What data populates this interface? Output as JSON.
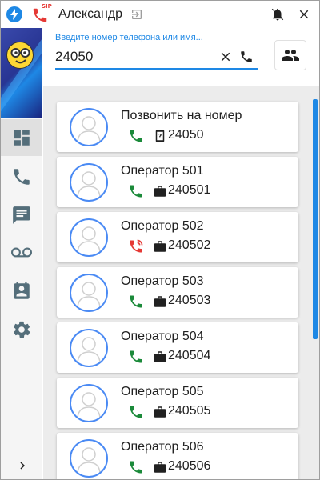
{
  "titlebar": {
    "sip_badge": "SIP",
    "user_name": "Александр"
  },
  "search": {
    "hint": "Введите номер телефона или имя...",
    "value": "24050"
  },
  "colors": {
    "accent": "#1e88e5",
    "call_green": "#1b8a3a",
    "call_red": "#e53935",
    "icon_grey": "#546e7a"
  },
  "sidebar": {
    "items": [
      {
        "name": "dashboard",
        "icon": "dashboard-icon",
        "active": true
      },
      {
        "name": "calls",
        "icon": "phone-icon",
        "active": false
      },
      {
        "name": "messages",
        "icon": "message-icon",
        "active": false
      },
      {
        "name": "voicemail",
        "icon": "voicemail-icon",
        "active": false
      },
      {
        "name": "contacts",
        "icon": "contact-card-icon",
        "active": false
      },
      {
        "name": "settings",
        "icon": "gear-icon",
        "active": false
      }
    ]
  },
  "list": {
    "items": [
      {
        "name": "Позвонить на номер",
        "number": "24050",
        "status": "available",
        "type": "unknown"
      },
      {
        "name": "Оператор 501",
        "number": "240501",
        "status": "available",
        "type": "work"
      },
      {
        "name": "Оператор 502",
        "number": "240502",
        "status": "busy",
        "type": "work"
      },
      {
        "name": "Оператор 503",
        "number": "240503",
        "status": "available",
        "type": "work"
      },
      {
        "name": "Оператор 504",
        "number": "240504",
        "status": "available",
        "type": "work"
      },
      {
        "name": "Оператор 505",
        "number": "240505",
        "status": "available",
        "type": "work"
      },
      {
        "name": "Оператор 506",
        "number": "240506",
        "status": "available",
        "type": "work"
      }
    ]
  }
}
